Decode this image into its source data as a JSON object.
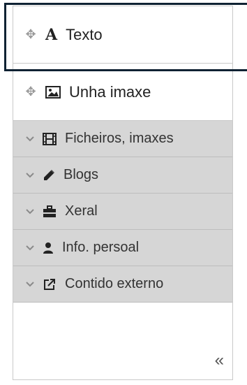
{
  "draggables": [
    {
      "label": "Texto",
      "icon": "text-format-icon"
    },
    {
      "label": "Unha imaxe",
      "icon": "image-icon"
    }
  ],
  "categories": [
    {
      "label": "Ficheiros, imaxes",
      "icon": "film-icon"
    },
    {
      "label": "Blogs",
      "icon": "pencil-icon"
    },
    {
      "label": "Xeral",
      "icon": "briefcase-icon"
    },
    {
      "label": "Info. persoal",
      "icon": "user-icon"
    },
    {
      "label": "Contido externo",
      "icon": "external-link-icon"
    }
  ],
  "collapse": {
    "label": "«"
  },
  "glyphs": {
    "move": "✥",
    "chevron": "⌄",
    "text": "A"
  },
  "colors": {
    "highlight": "#0f2233",
    "category_bg": "#d6d6d6",
    "border": "#c9c9c9"
  }
}
